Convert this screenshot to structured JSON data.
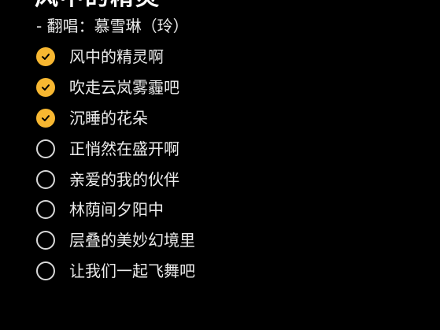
{
  "header": {
    "title": "风中的精灵",
    "subtitle": "- 翻唱：慕雪琳（玲）"
  },
  "colors": {
    "background": "#000000",
    "check_done": "#F7B731",
    "check_mark": "#000000",
    "check_todo_border": "#d8d8d8",
    "text": "#ececec"
  },
  "items": [
    {
      "label": "风中的精灵啊",
      "checked": true,
      "icon": "checkmark-circle-icon"
    },
    {
      "label": "吹走云岚雾霾吧",
      "checked": true,
      "icon": "checkmark-circle-icon"
    },
    {
      "label": "沉睡的花朵",
      "checked": true,
      "icon": "checkmark-circle-icon"
    },
    {
      "label": "正悄然在盛开啊",
      "checked": false,
      "icon": "empty-circle-icon"
    },
    {
      "label": "亲爱的我的伙伴",
      "checked": false,
      "icon": "empty-circle-icon"
    },
    {
      "label": "林荫间夕阳中",
      "checked": false,
      "icon": "empty-circle-icon"
    },
    {
      "label": "层叠的美妙幻境里",
      "checked": false,
      "icon": "empty-circle-icon"
    },
    {
      "label": "让我们一起飞舞吧",
      "checked": false,
      "icon": "empty-circle-icon"
    }
  ]
}
